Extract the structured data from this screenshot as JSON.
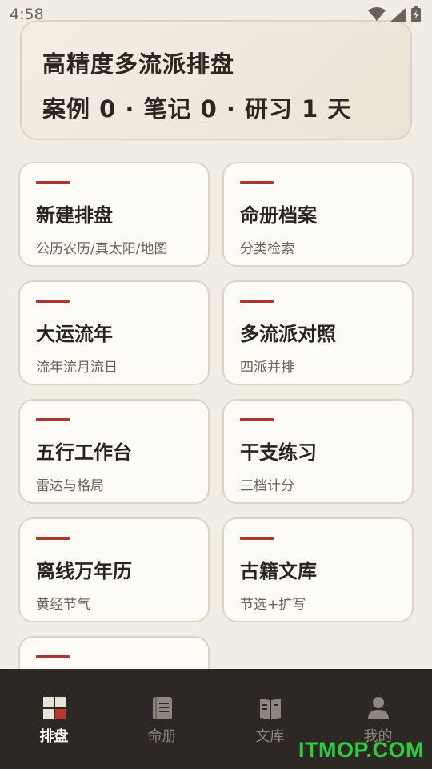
{
  "status": {
    "time": "4:58"
  },
  "header": {
    "title": "高精度多流派排盘",
    "stats": "案例 0 · 笔记 0 · 研习 1 天"
  },
  "cards": [
    {
      "title": "新建排盘",
      "subtitle": "公历农历/真太阳/地图"
    },
    {
      "title": "命册档案",
      "subtitle": "分类检索"
    },
    {
      "title": "大运流年",
      "subtitle": "流年流月流日"
    },
    {
      "title": "多流派对照",
      "subtitle": "四派并排"
    },
    {
      "title": "五行工作台",
      "subtitle": "雷达与格局"
    },
    {
      "title": "干支练习",
      "subtitle": "三档计分"
    },
    {
      "title": "离线万年历",
      "subtitle": "黄经节气"
    },
    {
      "title": "古籍文库",
      "subtitle": "节选+扩写"
    }
  ],
  "tabs": [
    {
      "label": "排盘",
      "icon": "chart-grid-icon",
      "active": true
    },
    {
      "label": "命册",
      "icon": "book-icon",
      "active": false
    },
    {
      "label": "文库",
      "icon": "library-icon",
      "active": false
    },
    {
      "label": "我的",
      "icon": "person-icon",
      "active": false
    }
  ],
  "watermark": "ITMOP.COM",
  "colors": {
    "accent": "#a8392c",
    "background": "#f2ede4",
    "tabbar": "#2e2824"
  }
}
